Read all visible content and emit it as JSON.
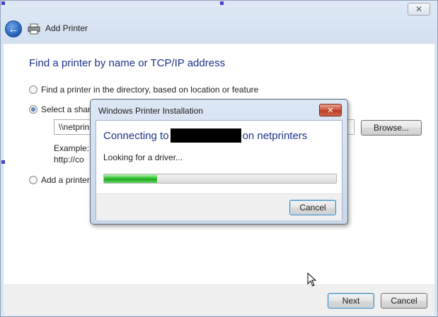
{
  "window": {
    "title": "Add Printer",
    "close_glyph": "✕",
    "back_glyph": "←"
  },
  "main": {
    "heading": "Find a printer by name or TCP/IP address",
    "options": [
      {
        "label": "Find a printer in the directory, based on location or feature",
        "checked": false
      },
      {
        "label": "Select a share",
        "checked": true
      },
      {
        "label": "Add a printer",
        "checked": false
      }
    ],
    "share_path_value": "\\\\netprin",
    "browse_label": "Browse...",
    "example_line1": "Example: \\",
    "example_line2": "http://co"
  },
  "footer": {
    "next_label": "Next",
    "cancel_label": "Cancel"
  },
  "dialog": {
    "title": "Windows Printer Installation",
    "close_glyph": "✕",
    "heading_prefix": "Connecting to",
    "heading_suffix": "on netprinters",
    "status": "Looking for a driver...",
    "progress_fraction": 0.23,
    "cancel_label": "Cancel"
  },
  "colors": {
    "heading_blue": "#1e3287",
    "progress_green": "#37c435",
    "close_red": "#c9513a"
  },
  "icons": [
    "back-arrow-icon",
    "printer-icon",
    "close-icon",
    "mouse-cursor-icon"
  ]
}
